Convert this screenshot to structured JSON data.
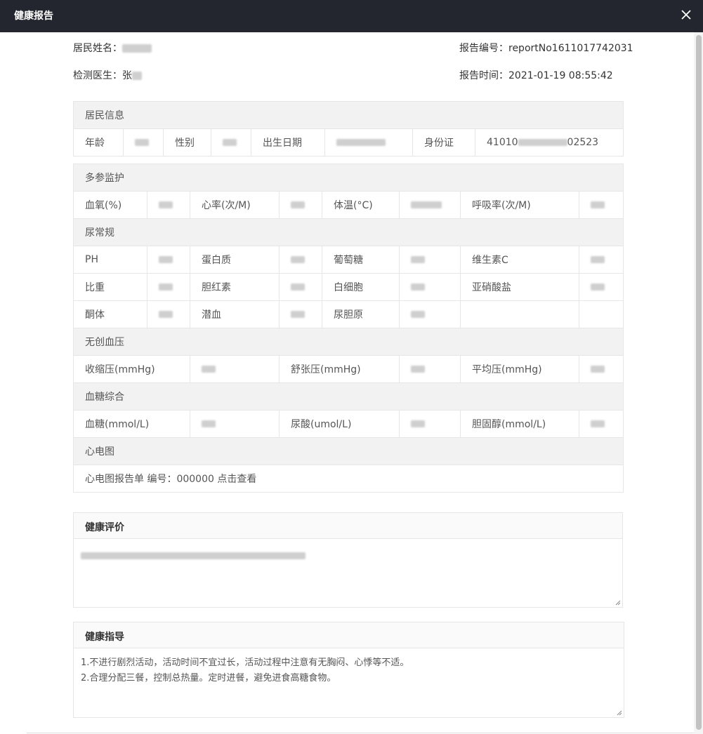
{
  "window": {
    "title": "健康报告"
  },
  "header": {
    "resident_name_label": "居民姓名：",
    "doctor_label": "检测医生：",
    "doctor_visible": "张",
    "report_no_label": "报告编号：",
    "report_no": "reportNo1611017742031",
    "report_time_label": "报告时间：",
    "report_time": "2021-01-19 08:55:42"
  },
  "resident_info": {
    "section": "居民信息",
    "age_label": "年龄",
    "gender_label": "性别",
    "birth_label": "出生日期",
    "id_label": "身份证",
    "id_prefix": "41010",
    "id_suffix": "02523"
  },
  "monitor": {
    "section": "多参监护",
    "spo2_label": "血氧(%)",
    "heart_rate_label": "心率(次/M)",
    "temp_label": "体温(°C)",
    "resp_label": "呼吸率(次/M)"
  },
  "urine": {
    "section": "尿常规",
    "ph_label": "PH",
    "protein_label": "蛋白质",
    "glucose_label": "葡萄糖",
    "vitc_label": "维生素C",
    "sg_label": "比重",
    "bilirubin_label": "胆红素",
    "wbc_label": "白细胞",
    "nitrite_label": "亚硝酸盐",
    "ketone_label": "酮体",
    "blood_label": "潜血",
    "urobilinogen_label": "尿胆原"
  },
  "bp": {
    "section": "无创血压",
    "systolic_label": "收缩压(mmHg)",
    "diastolic_label": "舒张压(mmHg)",
    "mean_label": "平均压(mmHg)"
  },
  "blood_glucose": {
    "section": "血糖综合",
    "glucose_label": "血糖(mmol/L)",
    "uric_label": "尿酸(umol/L)",
    "cholesterol_label": "胆固醇(mmol/L)"
  },
  "ecg": {
    "section": "心电图",
    "report_text": "心电图报告单 编号：000000 点击查看"
  },
  "evaluation": {
    "title": "健康评价"
  },
  "guidance": {
    "title": "健康指导",
    "line1": "1.不进行剧烈活动，活动时间不宜过长，活动过程中注意有无胸闷、心悸等不适。",
    "line2": "2.合理分配三餐，控制总热量。定时进餐，避免进食高糖食物。"
  },
  "colors": {
    "titlebar": "#23262e",
    "section_bg": "#f2f2f2",
    "border": "#e6e6e6"
  }
}
